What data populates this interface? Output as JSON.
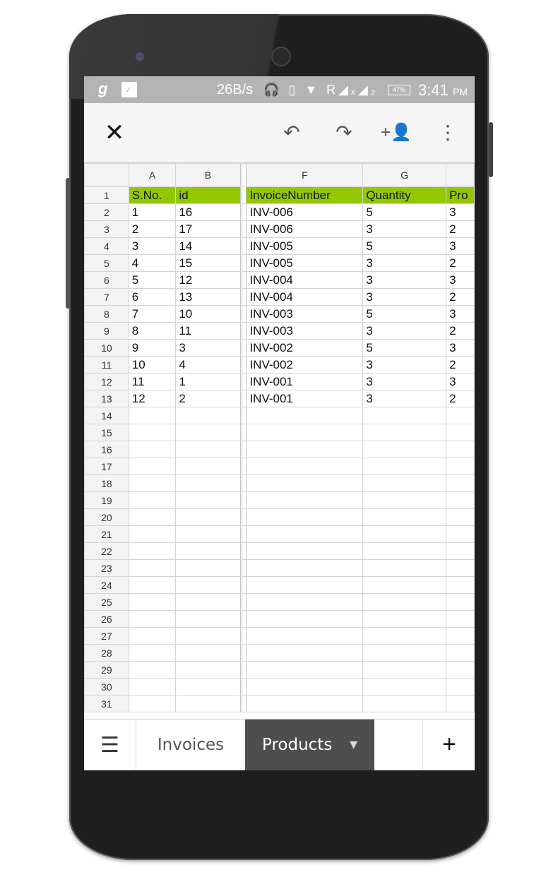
{
  "status_bar": {
    "app_icon": "g",
    "network_speed": "26B/s",
    "signal_icons": "🎧 ▯ ▼ R◢ₓ◢₂",
    "battery": "47%",
    "time": "3:41",
    "ampm": "PM"
  },
  "toolbar": {
    "close_icon": "✕",
    "undo_icon": "↶",
    "redo_icon": "↷",
    "share_icon": "+👤",
    "more_icon": "⋮"
  },
  "sheet": {
    "columns": [
      "A",
      "B",
      "F",
      "G",
      ""
    ],
    "header_row": [
      "S.No.",
      "id",
      "InvoiceNumber",
      "Quantity",
      "Pro"
    ],
    "rows": [
      [
        "1",
        "16",
        "INV-006",
        "5",
        "3"
      ],
      [
        "2",
        "17",
        "INV-006",
        "3",
        "2"
      ],
      [
        "3",
        "14",
        "INV-005",
        "5",
        "3"
      ],
      [
        "4",
        "15",
        "INV-005",
        "3",
        "2"
      ],
      [
        "5",
        "12",
        "INV-004",
        "3",
        "3"
      ],
      [
        "6",
        "13",
        "INV-004",
        "3",
        "2"
      ],
      [
        "7",
        "10",
        "INV-003",
        "5",
        "3"
      ],
      [
        "8",
        "11",
        "INV-003",
        "3",
        "2"
      ],
      [
        "9",
        "3",
        "INV-002",
        "5",
        "3"
      ],
      [
        "10",
        "4",
        "INV-002",
        "3",
        "2"
      ],
      [
        "11",
        "1",
        "INV-001",
        "3",
        "3"
      ],
      [
        "12",
        "2",
        "INV-001",
        "3",
        "2"
      ]
    ],
    "total_visible_rows": 31,
    "header_color": "#93c800"
  },
  "tabs": {
    "menu_icon": "☰",
    "items": [
      {
        "label": "Invoices",
        "active": false
      },
      {
        "label": "Products",
        "active": true
      }
    ],
    "dropdown_icon": "▼",
    "add_icon": "+"
  }
}
